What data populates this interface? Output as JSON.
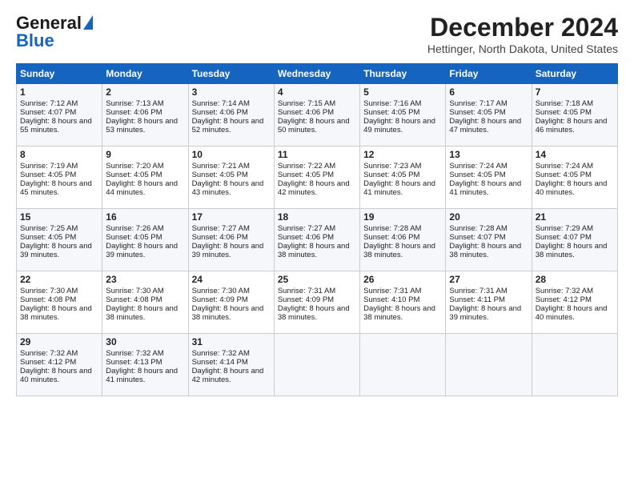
{
  "header": {
    "logo_line1": "General",
    "logo_line2": "Blue",
    "month_title": "December 2024",
    "location": "Hettinger, North Dakota, United States"
  },
  "days_of_week": [
    "Sunday",
    "Monday",
    "Tuesday",
    "Wednesday",
    "Thursday",
    "Friday",
    "Saturday"
  ],
  "weeks": [
    [
      {
        "day": "1",
        "sunrise": "Sunrise: 7:12 AM",
        "sunset": "Sunset: 4:07 PM",
        "daylight": "Daylight: 8 hours and 55 minutes."
      },
      {
        "day": "2",
        "sunrise": "Sunrise: 7:13 AM",
        "sunset": "Sunset: 4:06 PM",
        "daylight": "Daylight: 8 hours and 53 minutes."
      },
      {
        "day": "3",
        "sunrise": "Sunrise: 7:14 AM",
        "sunset": "Sunset: 4:06 PM",
        "daylight": "Daylight: 8 hours and 52 minutes."
      },
      {
        "day": "4",
        "sunrise": "Sunrise: 7:15 AM",
        "sunset": "Sunset: 4:06 PM",
        "daylight": "Daylight: 8 hours and 50 minutes."
      },
      {
        "day": "5",
        "sunrise": "Sunrise: 7:16 AM",
        "sunset": "Sunset: 4:05 PM",
        "daylight": "Daylight: 8 hours and 49 minutes."
      },
      {
        "day": "6",
        "sunrise": "Sunrise: 7:17 AM",
        "sunset": "Sunset: 4:05 PM",
        "daylight": "Daylight: 8 hours and 47 minutes."
      },
      {
        "day": "7",
        "sunrise": "Sunrise: 7:18 AM",
        "sunset": "Sunset: 4:05 PM",
        "daylight": "Daylight: 8 hours and 46 minutes."
      }
    ],
    [
      {
        "day": "8",
        "sunrise": "Sunrise: 7:19 AM",
        "sunset": "Sunset: 4:05 PM",
        "daylight": "Daylight: 8 hours and 45 minutes."
      },
      {
        "day": "9",
        "sunrise": "Sunrise: 7:20 AM",
        "sunset": "Sunset: 4:05 PM",
        "daylight": "Daylight: 8 hours and 44 minutes."
      },
      {
        "day": "10",
        "sunrise": "Sunrise: 7:21 AM",
        "sunset": "Sunset: 4:05 PM",
        "daylight": "Daylight: 8 hours and 43 minutes."
      },
      {
        "day": "11",
        "sunrise": "Sunrise: 7:22 AM",
        "sunset": "Sunset: 4:05 PM",
        "daylight": "Daylight: 8 hours and 42 minutes."
      },
      {
        "day": "12",
        "sunrise": "Sunrise: 7:23 AM",
        "sunset": "Sunset: 4:05 PM",
        "daylight": "Daylight: 8 hours and 41 minutes."
      },
      {
        "day": "13",
        "sunrise": "Sunrise: 7:24 AM",
        "sunset": "Sunset: 4:05 PM",
        "daylight": "Daylight: 8 hours and 41 minutes."
      },
      {
        "day": "14",
        "sunrise": "Sunrise: 7:24 AM",
        "sunset": "Sunset: 4:05 PM",
        "daylight": "Daylight: 8 hours and 40 minutes."
      }
    ],
    [
      {
        "day": "15",
        "sunrise": "Sunrise: 7:25 AM",
        "sunset": "Sunset: 4:05 PM",
        "daylight": "Daylight: 8 hours and 39 minutes."
      },
      {
        "day": "16",
        "sunrise": "Sunrise: 7:26 AM",
        "sunset": "Sunset: 4:05 PM",
        "daylight": "Daylight: 8 hours and 39 minutes."
      },
      {
        "day": "17",
        "sunrise": "Sunrise: 7:27 AM",
        "sunset": "Sunset: 4:06 PM",
        "daylight": "Daylight: 8 hours and 39 minutes."
      },
      {
        "day": "18",
        "sunrise": "Sunrise: 7:27 AM",
        "sunset": "Sunset: 4:06 PM",
        "daylight": "Daylight: 8 hours and 38 minutes."
      },
      {
        "day": "19",
        "sunrise": "Sunrise: 7:28 AM",
        "sunset": "Sunset: 4:06 PM",
        "daylight": "Daylight: 8 hours and 38 minutes."
      },
      {
        "day": "20",
        "sunrise": "Sunrise: 7:28 AM",
        "sunset": "Sunset: 4:07 PM",
        "daylight": "Daylight: 8 hours and 38 minutes."
      },
      {
        "day": "21",
        "sunrise": "Sunrise: 7:29 AM",
        "sunset": "Sunset: 4:07 PM",
        "daylight": "Daylight: 8 hours and 38 minutes."
      }
    ],
    [
      {
        "day": "22",
        "sunrise": "Sunrise: 7:30 AM",
        "sunset": "Sunset: 4:08 PM",
        "daylight": "Daylight: 8 hours and 38 minutes."
      },
      {
        "day": "23",
        "sunrise": "Sunrise: 7:30 AM",
        "sunset": "Sunset: 4:08 PM",
        "daylight": "Daylight: 8 hours and 38 minutes."
      },
      {
        "day": "24",
        "sunrise": "Sunrise: 7:30 AM",
        "sunset": "Sunset: 4:09 PM",
        "daylight": "Daylight: 8 hours and 38 minutes."
      },
      {
        "day": "25",
        "sunrise": "Sunrise: 7:31 AM",
        "sunset": "Sunset: 4:09 PM",
        "daylight": "Daylight: 8 hours and 38 minutes."
      },
      {
        "day": "26",
        "sunrise": "Sunrise: 7:31 AM",
        "sunset": "Sunset: 4:10 PM",
        "daylight": "Daylight: 8 hours and 38 minutes."
      },
      {
        "day": "27",
        "sunrise": "Sunrise: 7:31 AM",
        "sunset": "Sunset: 4:11 PM",
        "daylight": "Daylight: 8 hours and 39 minutes."
      },
      {
        "day": "28",
        "sunrise": "Sunrise: 7:32 AM",
        "sunset": "Sunset: 4:12 PM",
        "daylight": "Daylight: 8 hours and 40 minutes."
      }
    ],
    [
      {
        "day": "29",
        "sunrise": "Sunrise: 7:32 AM",
        "sunset": "Sunset: 4:12 PM",
        "daylight": "Daylight: 8 hours and 40 minutes."
      },
      {
        "day": "30",
        "sunrise": "Sunrise: 7:32 AM",
        "sunset": "Sunset: 4:13 PM",
        "daylight": "Daylight: 8 hours and 41 minutes."
      },
      {
        "day": "31",
        "sunrise": "Sunrise: 7:32 AM",
        "sunset": "Sunset: 4:14 PM",
        "daylight": "Daylight: 8 hours and 42 minutes."
      },
      null,
      null,
      null,
      null
    ]
  ]
}
